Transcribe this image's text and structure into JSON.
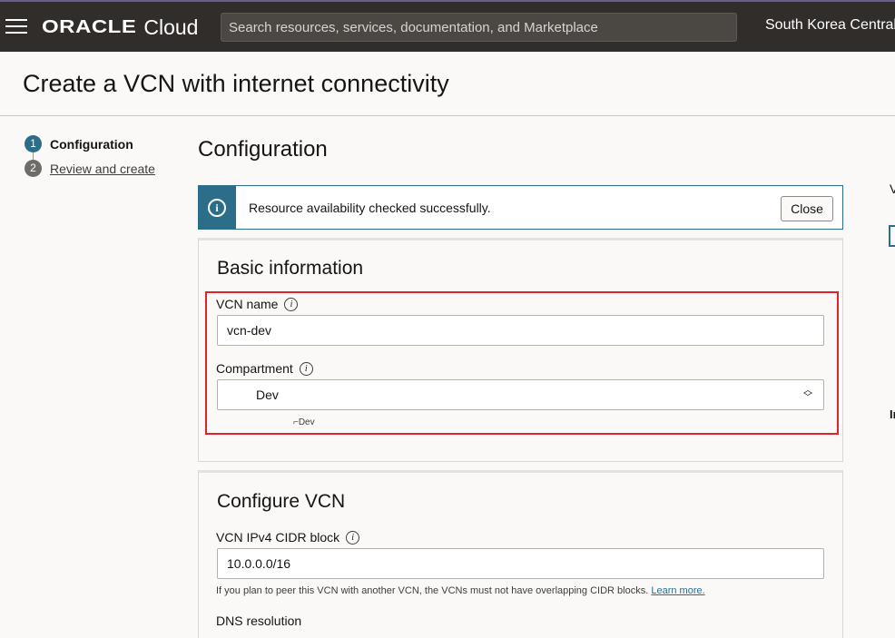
{
  "topbar": {
    "logo_brand": "ORACLE",
    "logo_product": "Cloud",
    "search_placeholder": "Search resources, services, documentation, and Marketplace",
    "region": "South Korea Central ("
  },
  "page": {
    "title": "Create a VCN with internet connectivity"
  },
  "steps": [
    {
      "number": "1",
      "label": "Configuration"
    },
    {
      "number": "2",
      "label": "Review and create"
    }
  ],
  "main": {
    "heading": "Configuration",
    "notice": {
      "message": "Resource availability checked successfully.",
      "close_label": "Close"
    },
    "basic_info": {
      "title": "Basic information",
      "vcn_name_label": "VCN name",
      "vcn_name_value": "vcn-dev",
      "compartment_label": "Compartment",
      "compartment_value": "Dev",
      "compartment_path": "⌐Dev"
    },
    "configure_vcn": {
      "title": "Configure VCN",
      "cidr_label": "VCN IPv4 CIDR block",
      "cidr_value": "10.0.0.0/16",
      "cidr_help": "If you plan to peer this VCN with another VCN, the VCNs must not have overlapping CIDR blocks.",
      "learn_more": "Learn more.",
      "dns_label": "DNS resolution"
    }
  },
  "right_panel": {
    "partial_text_1": "V",
    "partial_text_2": "Ir"
  },
  "colors": {
    "topbar_bg": "#312d2a",
    "accent": "#2c6e8a",
    "highlight": "#e0202a"
  }
}
